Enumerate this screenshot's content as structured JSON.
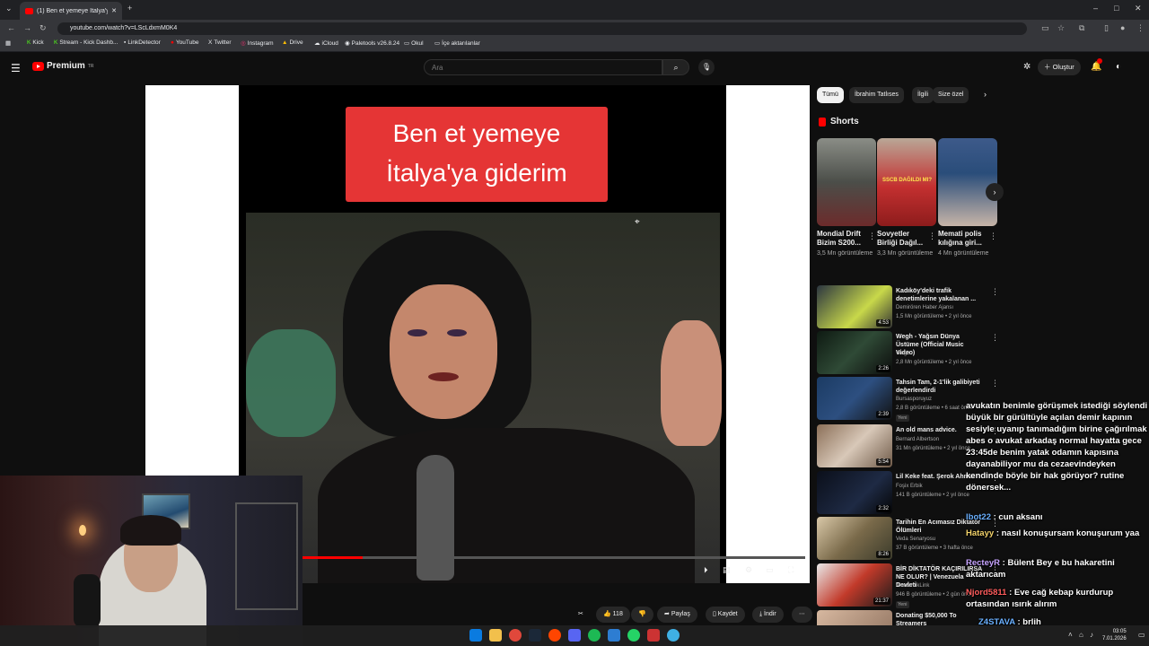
{
  "browser": {
    "tab_title": "(1) Ben et yemeye İtalya'ya gid",
    "url": "youtube.com/watch?v=LScLdxmM0K4",
    "bookmarks": [
      "Kick",
      "Stream - Kick Dashb...",
      "LinkDetector",
      "YouTube",
      "Twitter",
      "Instagram",
      "Drive",
      "iCloud",
      "Paletools v26.8.24",
      "Okul",
      "İçe aktarılanlar"
    ]
  },
  "header": {
    "logo_text": "Premium",
    "logo_sup": "TR",
    "search_placeholder": "Ara",
    "create_label": "Oluştur"
  },
  "video": {
    "caption_line1": "Ben et yemeye",
    "caption_line2": "İtalya'ya giderim",
    "progress": 0.12
  },
  "actions": {
    "likes": "118",
    "share": "Paylaş",
    "save": "Kaydet",
    "download": "İndir"
  },
  "chips": [
    "Tümü",
    "İbrahim Tatlıses",
    "İlgili",
    "Size özel"
  ],
  "shorts": {
    "title": "Shorts",
    "items": [
      {
        "title": "Mondial Drift Bizim S200...",
        "views": "3,5 Mn görüntüleme"
      },
      {
        "title": "Sovyetler Birliği Dağıl...",
        "views": "3,3 Mn görüntüleme"
      },
      {
        "title": "Memati polis kılığına giri...",
        "views": "4 Mn görüntüleme"
      }
    ],
    "short2_label": "SSCB DAĞILDI MI?"
  },
  "recommended": [
    {
      "title": "Kadıköy'deki trafik denetimlerine yakalanan ...",
      "channel": "Demirören Haber Ajansı",
      "meta": "1,5 Mn görüntüleme • 2 yıl önce",
      "duration": "4:53"
    },
    {
      "title": "Wegh - Yağsın Dünya Üstüme (Official Music Video)",
      "channel": "Wegh",
      "meta": "2,8 Mn görüntüleme • 2 yıl önce",
      "duration": "2:26"
    },
    {
      "title": "Tahsin Tam, 2-1'lik galibiyeti değerlendirdi",
      "channel": "Bursasporuyuz",
      "meta": "2,8 B görüntüleme • 6 saat önce",
      "duration": "2:39",
      "tag": "Yeni"
    },
    {
      "title": "An old mans advice.",
      "channel": "Bernard Albertson",
      "meta": "31 Mn görüntüleme • 2 yıl önce",
      "duration": "5:54"
    },
    {
      "title": "Lil Keke feat. Şerok Ahmet",
      "channel": "Foşix Erbik",
      "meta": "141 B görüntüleme • 2 yıl önce",
      "duration": "2:32"
    },
    {
      "title": "Tarihin En Acımasız Diktatör Ölümleri",
      "channel": "Veda Senaryosu",
      "meta": "37 B görüntüleme • 3 hafta önce",
      "duration": "8:26"
    },
    {
      "title": "BİR DİKTATÖR KAÇIRILIRSA NE OLUR? | Venezuela Devleti",
      "channel": "AkademikLink",
      "meta": "946 B görüntüleme • 2 gün önce",
      "duration": "21:37",
      "tag": "Yeni"
    },
    {
      "title": "Donating $50,000 To Streamers",
      "channel": "",
      "meta": "",
      "duration": ""
    }
  ],
  "chat": {
    "message1": "avukatın benimle görüşmek istediği söylendi büyük bir gürültüyle açılan demir kapının sesiyle uyanıp tanımadığım birine çağırılmak abes o avukat arkadaş normal hayatta gece 23:45de benim yatak odamın kapısına dayanabiliyor mu da cezaevindeyken kendinde böyle bir hak görüyor? rutine dönersek...",
    "lines": [
      {
        "user": "lbot22",
        "text": ": cun aksanı"
      },
      {
        "user": "Hatayy",
        "text": ": nasıl konuşursam konuşurum yaa"
      },
      {
        "user": "RecteyR",
        "text": ": Bülent Bey e bu hakaretini aktarıcam"
      },
      {
        "user": "Njord5811",
        "text": ": Eve cağ kebap kurdurup ortasından ısırık alırım"
      },
      {
        "user": "Z4STAVA",
        "text": ": brlih"
      },
      {
        "user": "Njord5811",
        "text": ": ..."
      }
    ]
  },
  "taskbar": {
    "time": "03:05",
    "date": "7.01.2026"
  }
}
